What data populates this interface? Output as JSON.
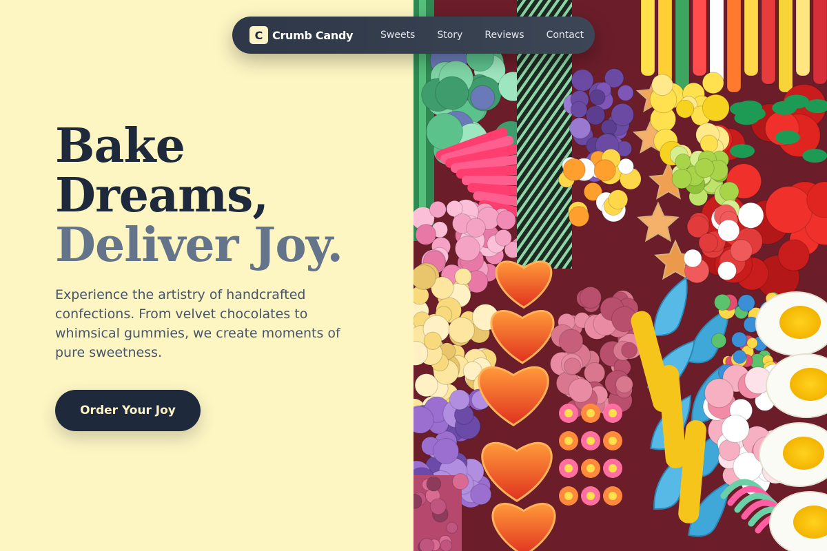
{
  "nav": {
    "logo_letter": "C",
    "brand": "Crumb Candy",
    "links": [
      "Sweets",
      "Story",
      "Reviews",
      "Contact"
    ]
  },
  "hero": {
    "headline_lines": [
      "Bake",
      "Dreams,",
      "Deliver Joy."
    ],
    "subtext": "Experience the artistry of handcrafted confections. From velvet chocolates to whimsical gummies, we create moments of pure sweetness.",
    "cta_label": "Order Your Joy"
  },
  "colors": {
    "background": "#fdf6c3",
    "heading": "#1e293b",
    "heading_accent": "#64748b",
    "body_text": "#475569",
    "button": "#1e293b",
    "button_text": "#fef3c7",
    "nav_background": "#2d3748"
  },
  "image": {
    "subject": "assorted colorful gummy candies"
  }
}
